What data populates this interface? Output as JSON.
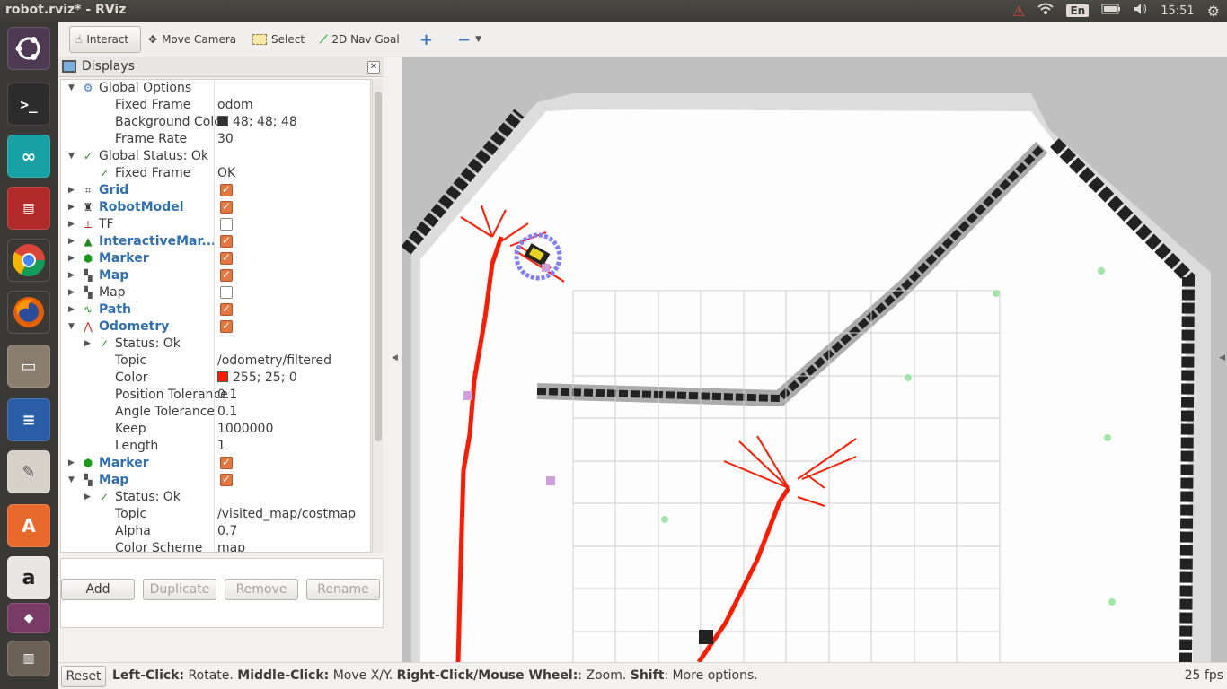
{
  "window": {
    "title": "robot.rviz* - RViz"
  },
  "tray": {
    "lang": "En",
    "time": "15:51"
  },
  "toolbar": {
    "interact": "Interact",
    "move_camera": "Move Camera",
    "select": "Select",
    "nav_goal": "2D Nav Goal"
  },
  "displays": {
    "title": "Displays",
    "rows": [
      {
        "name": "Global Options",
        "value": "",
        "depth": 0,
        "expander": "open",
        "icon": "gear-icon",
        "style": "plain"
      },
      {
        "name": "Fixed Frame",
        "value": "odom",
        "depth": 1,
        "expander": "",
        "icon": "",
        "style": "plain"
      },
      {
        "name": "Background Color",
        "value": "48; 48; 48",
        "swatch": "#303030",
        "depth": 1,
        "expander": "",
        "icon": "",
        "style": "plain"
      },
      {
        "name": "Frame Rate",
        "value": "30",
        "depth": 1,
        "expander": "",
        "icon": "",
        "style": "plain"
      },
      {
        "name": "Global Status: Ok",
        "value": "",
        "depth": 0,
        "expander": "open",
        "icon": "check-icon",
        "style": "plain"
      },
      {
        "name": "Fixed Frame",
        "value": "OK",
        "depth": 1,
        "expander": "",
        "icon": "check-icon",
        "style": "plain"
      },
      {
        "name": "Grid",
        "check": true,
        "depth": 0,
        "expander": "closed",
        "icon": "grid-icon",
        "style": "blue"
      },
      {
        "name": "RobotModel",
        "check": true,
        "depth": 0,
        "expander": "closed",
        "icon": "robot-icon",
        "style": "blue"
      },
      {
        "name": "TF",
        "check": false,
        "depth": 0,
        "expander": "closed",
        "icon": "tf-icon",
        "style": "plain"
      },
      {
        "name": "InteractiveMar...",
        "check": true,
        "depth": 0,
        "expander": "closed",
        "icon": "interactive-marker-icon",
        "style": "blue"
      },
      {
        "name": "Marker",
        "check": true,
        "depth": 0,
        "expander": "closed",
        "icon": "marker-icon",
        "style": "blue"
      },
      {
        "name": "Map",
        "check": true,
        "depth": 0,
        "expander": "closed",
        "icon": "map-icon",
        "style": "blue"
      },
      {
        "name": "Map",
        "check": false,
        "depth": 0,
        "expander": "closed",
        "icon": "map-icon",
        "style": "plain"
      },
      {
        "name": "Path",
        "check": true,
        "depth": 0,
        "expander": "closed",
        "icon": "path-icon",
        "style": "blue"
      },
      {
        "name": "Odometry",
        "check": true,
        "depth": 0,
        "expander": "open",
        "icon": "odometry-icon",
        "style": "blue"
      },
      {
        "name": "Status: Ok",
        "value": "",
        "depth": 1,
        "expander": "closed",
        "icon": "check-icon",
        "style": "plain"
      },
      {
        "name": "Topic",
        "value": "/odometry/filtered",
        "depth": 1,
        "expander": "",
        "icon": "",
        "style": "plain"
      },
      {
        "name": "Color",
        "value": "255; 25; 0",
        "swatch": "#ff1900",
        "depth": 1,
        "expander": "",
        "icon": "",
        "style": "plain"
      },
      {
        "name": "Position Tolerance",
        "value": "0.1",
        "depth": 1,
        "expander": "",
        "icon": "",
        "style": "plain"
      },
      {
        "name": "Angle Tolerance",
        "value": "0.1",
        "depth": 1,
        "expander": "",
        "icon": "",
        "style": "plain"
      },
      {
        "name": "Keep",
        "value": "1000000",
        "depth": 1,
        "expander": "",
        "icon": "",
        "style": "plain"
      },
      {
        "name": "Length",
        "value": "1",
        "depth": 1,
        "expander": "",
        "icon": "",
        "style": "plain"
      },
      {
        "name": "Marker",
        "check": true,
        "depth": 0,
        "expander": "closed",
        "icon": "marker-icon",
        "style": "blue"
      },
      {
        "name": "Map",
        "check": true,
        "depth": 0,
        "expander": "open",
        "icon": "map-icon",
        "style": "blue"
      },
      {
        "name": "Status: Ok",
        "value": "",
        "depth": 1,
        "expander": "closed",
        "icon": "check-icon",
        "style": "plain"
      },
      {
        "name": "Topic",
        "value": "/visited_map/costmap",
        "depth": 1,
        "expander": "",
        "icon": "",
        "style": "plain"
      },
      {
        "name": "Alpha",
        "value": "0.7",
        "depth": 1,
        "expander": "",
        "icon": "",
        "style": "plain"
      },
      {
        "name": "Color Scheme",
        "value": "map",
        "depth": 1,
        "expander": "",
        "icon": "",
        "style": "plain"
      }
    ],
    "buttons": {
      "add": "Add",
      "duplicate": "Duplicate",
      "remove": "Remove",
      "rename": "Rename"
    }
  },
  "status": {
    "reset": "Reset",
    "hint": [
      {
        "text": "Left-Click:",
        "bold": true
      },
      {
        "text": " Rotate. ",
        "bold": false
      },
      {
        "text": "Middle-Click:",
        "bold": true
      },
      {
        "text": " Move X/Y. ",
        "bold": false
      },
      {
        "text": "Right-Click/Mouse Wheel:",
        "bold": true
      },
      {
        "text": ": Zoom. ",
        "bold": false
      },
      {
        "text": "Shift",
        "bold": true
      },
      {
        "text": ": More options.",
        "bold": false
      }
    ],
    "fps": "25 fps"
  },
  "colors": {
    "path": "#ff1a00",
    "map_free": "#fefefe",
    "map_unknown": "#bdbdbd",
    "wall": "#222222"
  }
}
